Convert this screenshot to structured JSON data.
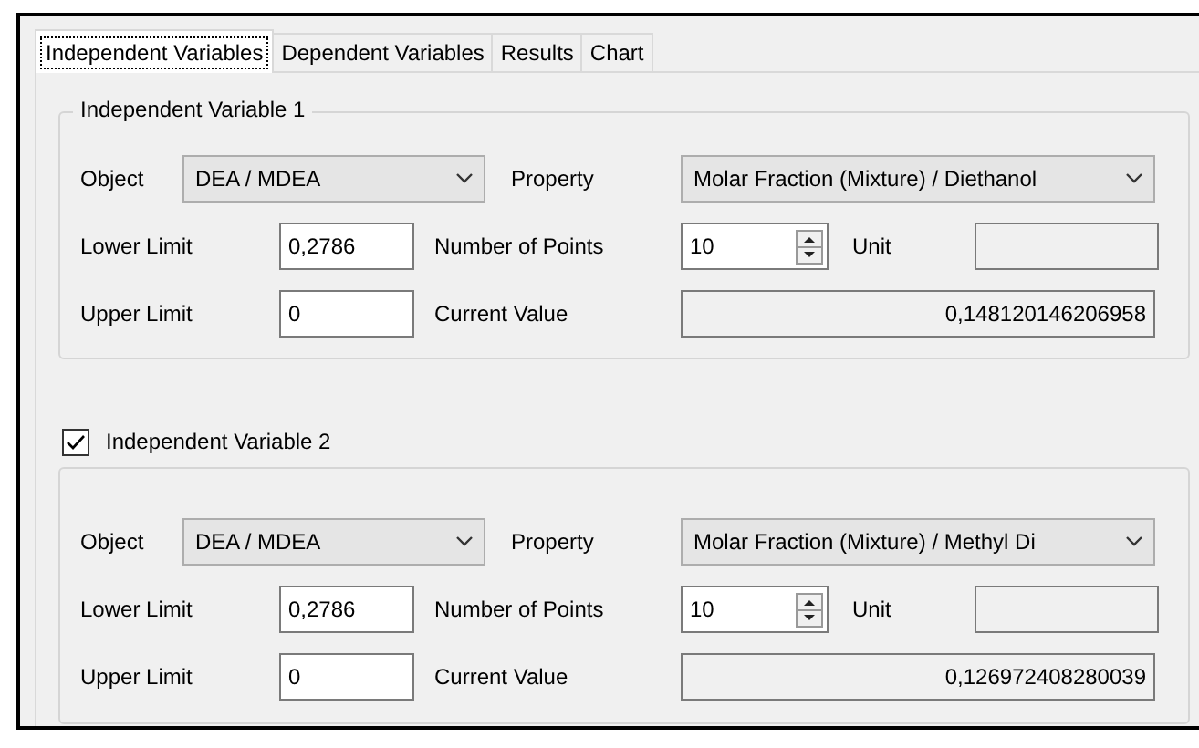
{
  "tabs": [
    {
      "label": "Independent Variables",
      "selected": true
    },
    {
      "label": "Dependent Variables",
      "selected": false
    },
    {
      "label": "Results",
      "selected": false
    },
    {
      "label": "Chart",
      "selected": false
    }
  ],
  "variables": [
    {
      "kind": "group",
      "title": "Independent Variable 1",
      "object_label": "Object",
      "object": "DEA / MDEA",
      "property_label": "Property",
      "property": "Molar Fraction (Mixture) / Diethanol",
      "lower_label": "Lower Limit",
      "lower_limit": "0,2786",
      "points_label": "Number of Points",
      "number_of_points": "10",
      "unit_label": "Unit",
      "upper_label": "Upper Limit",
      "upper_limit": "0",
      "current_label": "Current Value",
      "current_value": "0,148120146206958"
    },
    {
      "kind": "checkbox",
      "title": "Independent Variable 2",
      "checked": true,
      "object_label": "Object",
      "object": "DEA / MDEA",
      "property_label": "Property",
      "property": "Molar Fraction (Mixture) / Methyl Di",
      "lower_label": "Lower Limit",
      "lower_limit": "0,2786",
      "points_label": "Number of Points",
      "number_of_points": "10",
      "unit_label": "Unit",
      "upper_label": "Upper Limit",
      "upper_limit": "0",
      "current_label": "Current Value",
      "current_value": "0,126972408280039"
    }
  ]
}
